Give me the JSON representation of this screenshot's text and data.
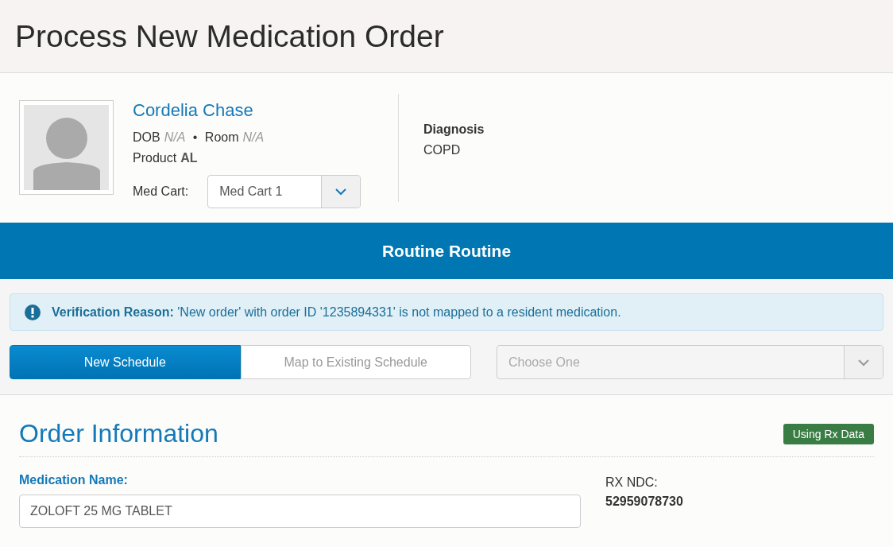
{
  "page_title": "Process New Medication Order",
  "patient": {
    "name": "Cordelia Chase",
    "dob_label": "DOB",
    "dob": "N/A",
    "separator": "•",
    "room_label": "Room",
    "room": "N/A",
    "product_label": "Product",
    "product": "AL",
    "med_cart_label": "Med Cart:",
    "med_cart": "Med Cart 1"
  },
  "diagnosis": {
    "label": "Diagnosis",
    "value": "COPD"
  },
  "banner": "Routine Routine",
  "alert": "**Verification Reason:** 'New order' with order ID '1235894331' is not mapped to a resident medication.",
  "schedule_tabs": [
    {
      "label": "New Schedule",
      "selected": true
    },
    {
      "label": "Map to Existing Schedule",
      "selected": false
    }
  ],
  "schedule_select": {
    "placeholder": "Choose One",
    "disabled": true
  },
  "order": {
    "title": "Order Information",
    "badge": "Using Rx Data",
    "medication_label": "Medication Name:",
    "medication": "ZOLOFT 25 MG TABLET",
    "ndc_label": "RX NDC:",
    "ndc": "52959078730"
  }
}
